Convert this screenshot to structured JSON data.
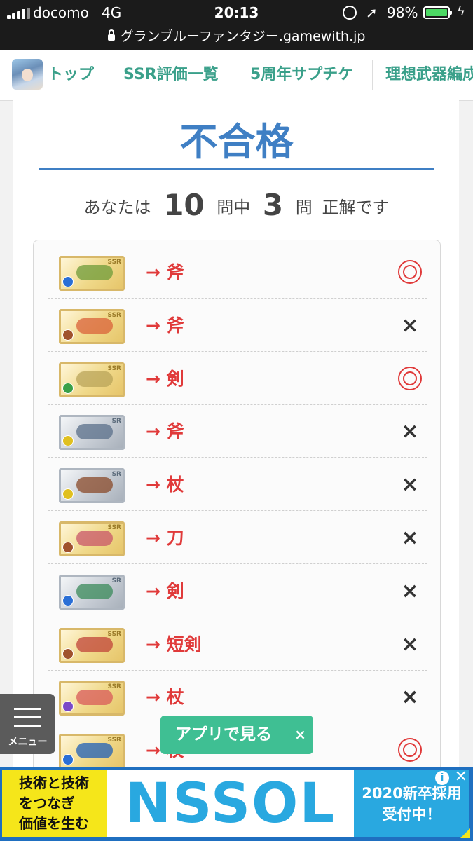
{
  "status_bar": {
    "carrier": "docomo",
    "network": "4G",
    "time": "20:13",
    "battery": "98%",
    "battery_level": 0.98,
    "url": "グランブルーファンタジー.gamewith.jp"
  },
  "nav": {
    "items": [
      {
        "label": "トップ"
      },
      {
        "label": "SSR評価一覧"
      },
      {
        "label": "5周年サプチケ"
      },
      {
        "label": "理想武器編成"
      }
    ]
  },
  "result": {
    "title": "不合格",
    "prefix": "あなたは",
    "total": "10",
    "mid1": "問中",
    "correct": "3",
    "mid2": "問",
    "suffix": "正解です"
  },
  "questions": [
    {
      "rarity": "SSR",
      "answer": "→ 斧",
      "mark": "◎",
      "orb_color": "#2a6fd6",
      "art_color": "#6e9b3a"
    },
    {
      "rarity": "SSR",
      "answer": "→ 斧",
      "mark": "×",
      "orb_color": "#a0522d",
      "art_color": "#d9623a"
    },
    {
      "rarity": "SSR",
      "answer": "→ 剣",
      "mark": "◎",
      "orb_color": "#3aa048",
      "art_color": "#b9a45a"
    },
    {
      "rarity": "SR",
      "answer": "→ 斧",
      "mark": "×",
      "orb_color": "#e0c020",
      "art_color": "#5a6f8a"
    },
    {
      "rarity": "SR",
      "answer": "→ 杖",
      "mark": "×",
      "orb_color": "#e0c020",
      "art_color": "#8a4a2a"
    },
    {
      "rarity": "SSR",
      "answer": "→ 刀",
      "mark": "×",
      "orb_color": "#a0522d",
      "art_color": "#c8556a"
    },
    {
      "rarity": "SR",
      "answer": "→ 剣",
      "mark": "×",
      "orb_color": "#2a6fd6",
      "art_color": "#3a8a5a"
    },
    {
      "rarity": "SSR",
      "answer": "→ 短剣",
      "mark": "×",
      "orb_color": "#a0522d",
      "art_color": "#c0443a"
    },
    {
      "rarity": "SSR",
      "answer": "→ 杖",
      "mark": "×",
      "orb_color": "#7a4ac8",
      "art_color": "#d85a5a"
    },
    {
      "rarity": "SSR",
      "answer": "→ 杖",
      "mark": "◎",
      "orb_color": "#2a6fd6",
      "art_color": "#1e5fb8"
    }
  ],
  "menu": {
    "label": "メニュー"
  },
  "app_banner": {
    "label": "アプリで見る",
    "close": "×"
  },
  "ad": {
    "left_lines": [
      "技術と技術",
      "をつなぎ",
      "価値を生む"
    ],
    "brand": "NSSOL",
    "right_lines": [
      "2020新卒採用",
      "受付中！"
    ],
    "info": "i",
    "close": "✕"
  },
  "colors": {
    "accent_blue": "#3f7fc4",
    "nav_green": "#3aa08a",
    "answer_red": "#e03a3a",
    "app_green": "#3fbf93"
  }
}
